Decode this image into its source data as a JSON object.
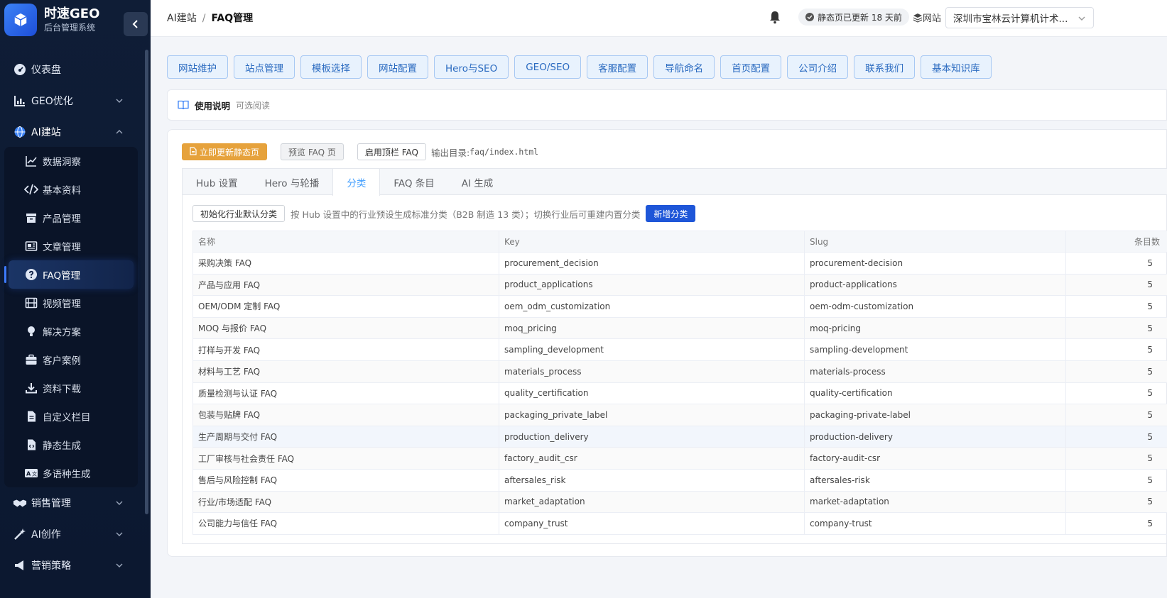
{
  "brand": {
    "title": "时速GEO",
    "subtitle": "后台管理系统"
  },
  "sidebar": {
    "top": [
      {
        "label": "仪表盘",
        "icon": "dashboard-icon"
      },
      {
        "label": "GEO优化",
        "icon": "chart-bar-icon"
      },
      {
        "label": "AI建站",
        "icon": "globe-icon"
      }
    ],
    "sub": [
      {
        "label": "数据洞察",
        "icon": "line-chart-icon"
      },
      {
        "label": "基本资料",
        "icon": "code-icon"
      },
      {
        "label": "产品管理",
        "icon": "box-icon"
      },
      {
        "label": "文章管理",
        "icon": "newspaper-icon"
      },
      {
        "label": "FAQ管理",
        "icon": "question-icon"
      },
      {
        "label": "视频管理",
        "icon": "film-icon"
      },
      {
        "label": "解决方案",
        "icon": "bulb-icon"
      },
      {
        "label": "客户案例",
        "icon": "briefcase-icon"
      },
      {
        "label": "资料下载",
        "icon": "download-icon"
      },
      {
        "label": "自定义栏目",
        "icon": "file-icon"
      },
      {
        "label": "静态生成",
        "icon": "file-code-icon"
      },
      {
        "label": "多语种生成",
        "icon": "translate-icon"
      }
    ],
    "bottom": [
      {
        "label": "销售管理",
        "icon": "handshake-icon"
      },
      {
        "label": "AI创作",
        "icon": "magic-wand-icon"
      },
      {
        "label": "营销策略",
        "icon": "megaphone-icon"
      }
    ]
  },
  "header": {
    "crumb_root": "AI建站",
    "crumb_current": "FAQ管理",
    "static_status": "静态页已更新 18 天前",
    "site_label": "网站",
    "site_value": "深圳市宝林云计算机计术..."
  },
  "toolbar": [
    "网站维护",
    "站点管理",
    "模板选择",
    "网站配置",
    "Hero与SEO",
    "GEO/SEO",
    "客服配置",
    "导航命名",
    "首页配置",
    "公司介绍",
    "联系我们",
    "基本知识库"
  ],
  "usage": {
    "title": "使用说明",
    "note": "可选阅读"
  },
  "actions": {
    "update_static": "立即更新静态页",
    "preview": "预览 FAQ 页",
    "enable_top": "启用顶栏 FAQ",
    "output_label": "输出目录:",
    "output_path": "faq/index.html"
  },
  "tabs": [
    "Hub 设置",
    "Hero 与轮播",
    "分类",
    "FAQ 条目",
    "AI 生成"
  ],
  "category": {
    "init_button": "初始化行业默认分类",
    "hint": "按 Hub 设置中的行业预设生成标准分类（B2B 制造 13 类）；切换行业后可重建内置分类",
    "add_button": "新增分类"
  },
  "table": {
    "columns": [
      "名称",
      "Key",
      "Slug",
      "条目数"
    ],
    "rows": [
      [
        "采购决策 FAQ",
        "procurement_decision",
        "procurement-decision",
        "5"
      ],
      [
        "产品与应用 FAQ",
        "product_applications",
        "product-applications",
        "5"
      ],
      [
        "OEM/ODM 定制 FAQ",
        "oem_odm_customization",
        "oem-odm-customization",
        "5"
      ],
      [
        "MOQ 与报价 FAQ",
        "moq_pricing",
        "moq-pricing",
        "5"
      ],
      [
        "打样与开发 FAQ",
        "sampling_development",
        "sampling-development",
        "5"
      ],
      [
        "材料与工艺 FAQ",
        "materials_process",
        "materials-process",
        "5"
      ],
      [
        "质量检测与认证 FAQ",
        "quality_certification",
        "quality-certification",
        "5"
      ],
      [
        "包装与贴牌 FAQ",
        "packaging_private_label",
        "packaging-private-label",
        "5"
      ],
      [
        "生产周期与交付 FAQ",
        "production_delivery",
        "production-delivery",
        "5"
      ],
      [
        "工厂审核与社会责任 FAQ",
        "factory_audit_csr",
        "factory-audit-csr",
        "5"
      ],
      [
        "售后与风险控制 FAQ",
        "aftersales_risk",
        "aftersales-risk",
        "5"
      ],
      [
        "行业/市场适配 FAQ",
        "market_adaptation",
        "market-adaptation",
        "5"
      ],
      [
        "公司能力与信任 FAQ",
        "company_trust",
        "company-trust",
        "5"
      ]
    ]
  },
  "colors": {
    "sidebar_bg": "#0f1d36",
    "primary": "#1e56d8",
    "warning": "#e6a23c",
    "tab_active": "#409eff"
  }
}
